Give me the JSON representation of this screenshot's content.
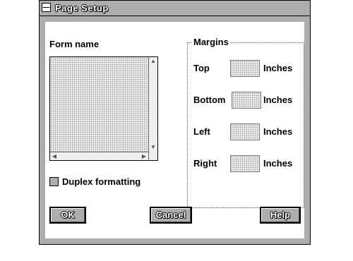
{
  "window": {
    "title": "Page Setup",
    "system_menu_glyph": "—"
  },
  "form_name": {
    "label": "Form name"
  },
  "duplex": {
    "label": "Duplex formatting",
    "checked": false
  },
  "margins": {
    "group_label": "Margins",
    "rows": [
      {
        "label": "Top",
        "value": "",
        "unit": "Inches"
      },
      {
        "label": "Bottom",
        "value": "",
        "unit": "Inches"
      },
      {
        "label": "Left",
        "value": "",
        "unit": "Inches"
      },
      {
        "label": "Right",
        "value": "",
        "unit": "Inches"
      }
    ]
  },
  "buttons": {
    "ok": "OK",
    "cancel": "Cancel",
    "help": "Help"
  },
  "icons": {
    "system_menu": "system-menu-icon",
    "scroll_up": "scroll-up-arrow-icon",
    "scroll_down": "scroll-down-arrow-icon",
    "scroll_left": "scroll-left-arrow-icon",
    "scroll_right": "scroll-right-arrow-icon"
  }
}
